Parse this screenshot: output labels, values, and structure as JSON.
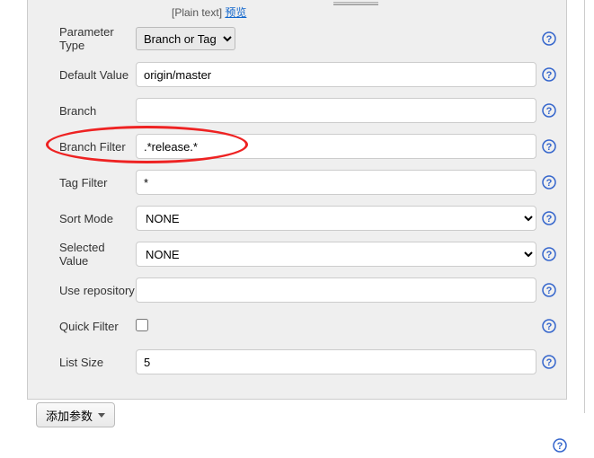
{
  "plain_text_label": "[Plain text]",
  "preview_link": "预览",
  "rows": {
    "parameter_type": {
      "label": "Parameter Type",
      "value": "Branch or Tag"
    },
    "default_value": {
      "label": "Default Value",
      "value": "origin/master"
    },
    "branch": {
      "label": "Branch",
      "value": ""
    },
    "branch_filter": {
      "label": "Branch Filter",
      "value": ".*release.*"
    },
    "tag_filter": {
      "label": "Tag Filter",
      "value": "*"
    },
    "sort_mode": {
      "label": "Sort Mode",
      "value": "NONE"
    },
    "selected_value": {
      "label": "Selected Value",
      "value": "NONE"
    },
    "use_repository": {
      "label": "Use repository",
      "value": ""
    },
    "quick_filter": {
      "label": "Quick Filter",
      "checked": false
    },
    "list_size": {
      "label": "List Size",
      "value": "5"
    }
  },
  "add_param_button": "添加参数"
}
